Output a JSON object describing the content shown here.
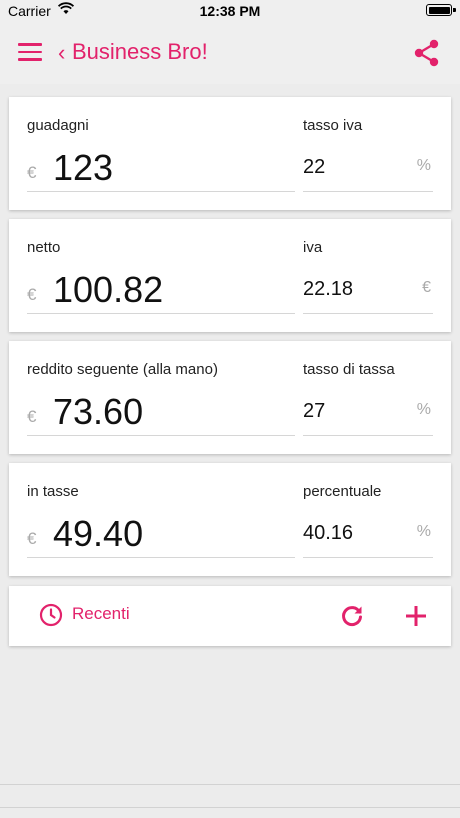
{
  "status_bar": {
    "carrier": "Carrier",
    "time": "12:38 PM"
  },
  "app_bar": {
    "back_chevron": "‹",
    "title": "Business Bro!",
    "icons": [
      "menu-icon",
      "back-chevron-icon",
      "share-icon"
    ]
  },
  "cards": [
    {
      "left_label": "guadagni",
      "left_currency": "€",
      "left_value": "123",
      "right_label": "tasso iva",
      "right_value": "22",
      "right_unit": "%"
    },
    {
      "left_label": "netto",
      "left_currency": "€",
      "left_value": "100.82",
      "right_label": "iva",
      "right_value": "22.18",
      "right_unit": "€"
    },
    {
      "left_label": "reddito seguente (alla mano)",
      "left_currency": "€",
      "left_value": "73.60",
      "right_label": "tasso di tassa",
      "right_value": "27",
      "right_unit": "%"
    },
    {
      "left_label": "in tasse",
      "left_currency": "€",
      "left_value": "49.40",
      "right_label": "percentuale",
      "right_value": "40.16",
      "right_unit": "%"
    }
  ],
  "actions": {
    "recent_label": "Recenti",
    "icons": [
      "clock-icon",
      "refresh-icon",
      "add-icon"
    ]
  },
  "colors": {
    "accent": "#e2226b",
    "background": "#ececec",
    "card": "#ffffff",
    "muted": "#aaaaaa"
  }
}
